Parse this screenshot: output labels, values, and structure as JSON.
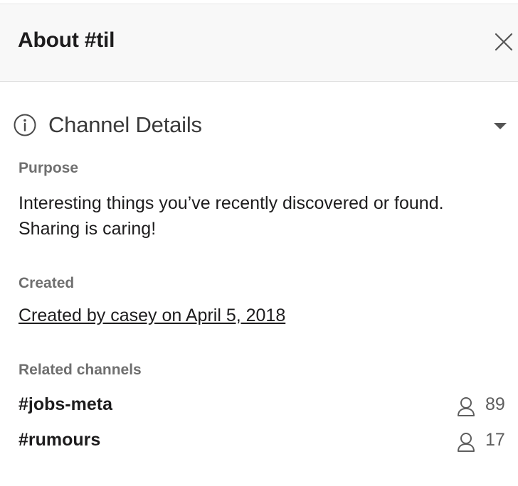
{
  "header": {
    "title": "About #til",
    "close_icon": "close-icon"
  },
  "details": {
    "section_title": "Channel Details",
    "info_icon": "info-icon",
    "caret_icon": "caret-down-icon",
    "purpose_label": "Purpose",
    "purpose_text": "Interesting things you’ve recently discovered or found. Sharing is caring!",
    "created_label": "Created",
    "created_text": "Created by casey on April 5, 2018",
    "related_label": "Related channels",
    "related_channels": [
      {
        "name": "#jobs-meta",
        "members": "89",
        "icon": "member-icon"
      },
      {
        "name": "#rumours",
        "members": "17",
        "icon": "member-icon"
      }
    ]
  },
  "colors": {
    "header_bg": "#f8f8f8",
    "text": "#1d1c1d",
    "label": "#6f6f6f"
  }
}
